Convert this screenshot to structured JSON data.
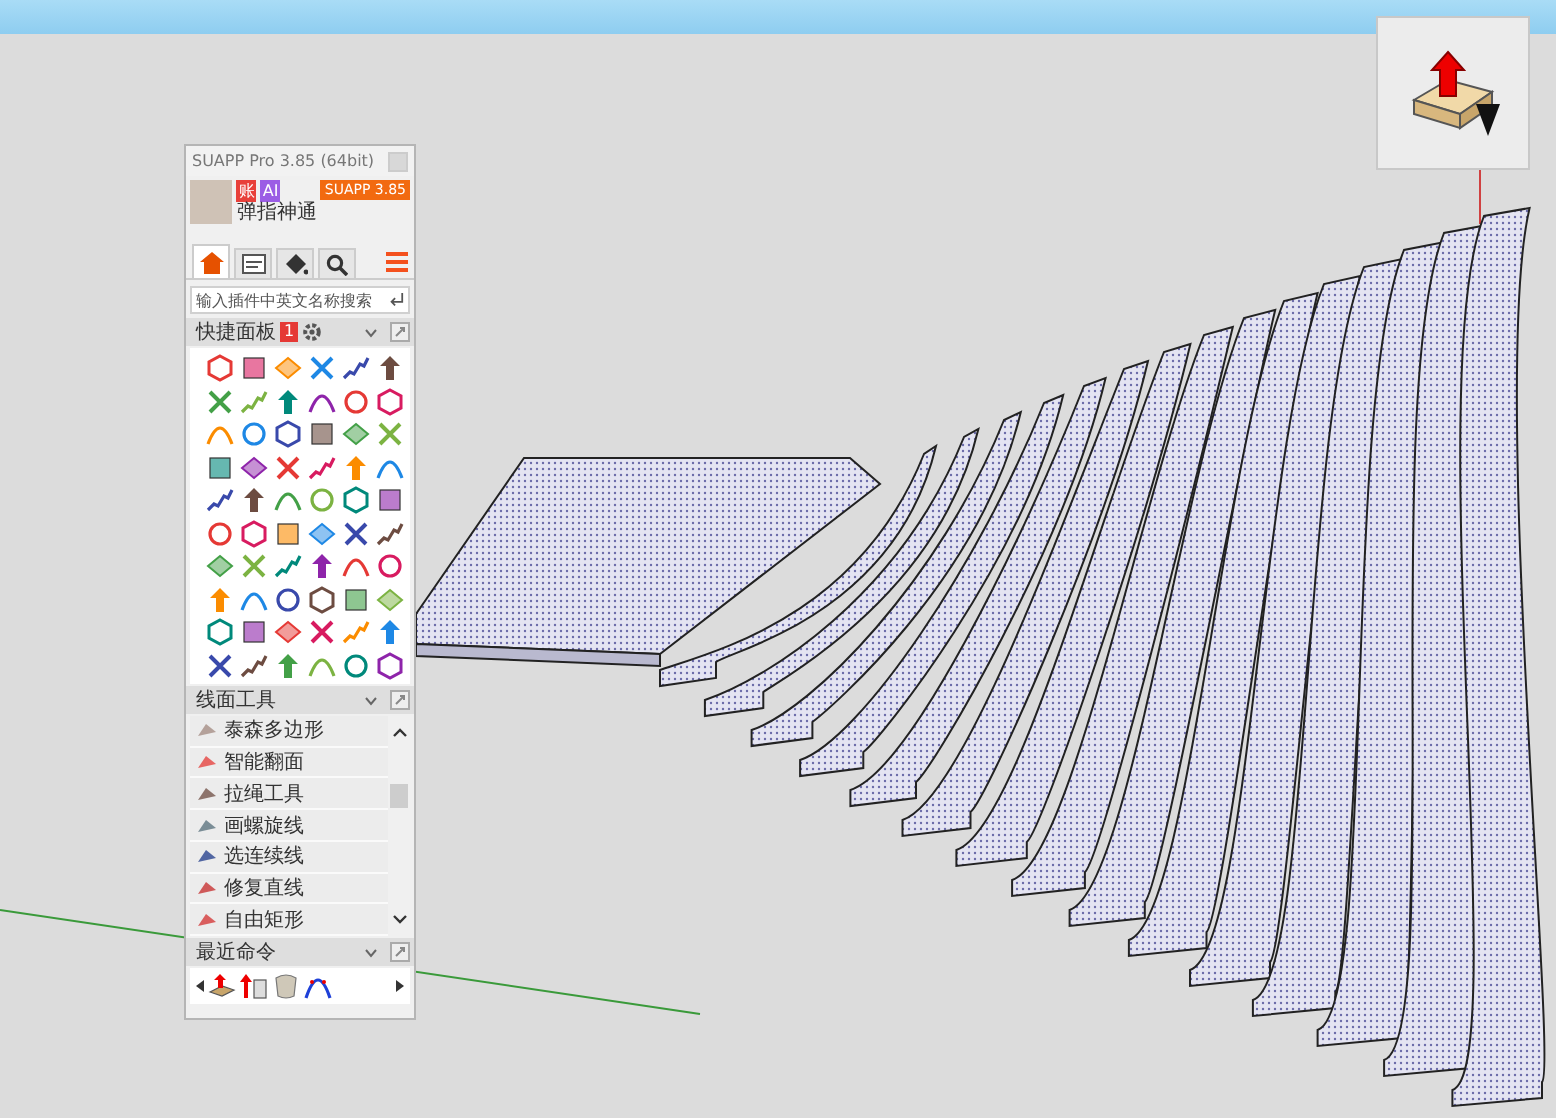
{
  "panel": {
    "title": "SUAPP Pro 3.85 (64bit)",
    "user": {
      "name": "弹指神通",
      "badges": [
        {
          "label": "账",
          "color": "#e8403a"
        },
        {
          "label": "AI",
          "color": "#9b5de5"
        }
      ]
    },
    "version_button": "SUAPP 3.85",
    "tabs": [
      {
        "selected": true
      },
      {
        "selected": false
      },
      {
        "selected": false
      },
      {
        "selected": false
      }
    ],
    "search": {
      "placeholder": "输入插件中英文名称搜索"
    },
    "quick_panel": {
      "title": "快捷面板",
      "badge": "1"
    },
    "line_tools": {
      "title": "线面工具",
      "items": [
        "泰森多边形",
        "智能翻面",
        "拉绳工具",
        "画螺旋线",
        "选连续线",
        "修复直线",
        "自由矩形"
      ]
    },
    "recent": {
      "title": "最近命令"
    }
  }
}
